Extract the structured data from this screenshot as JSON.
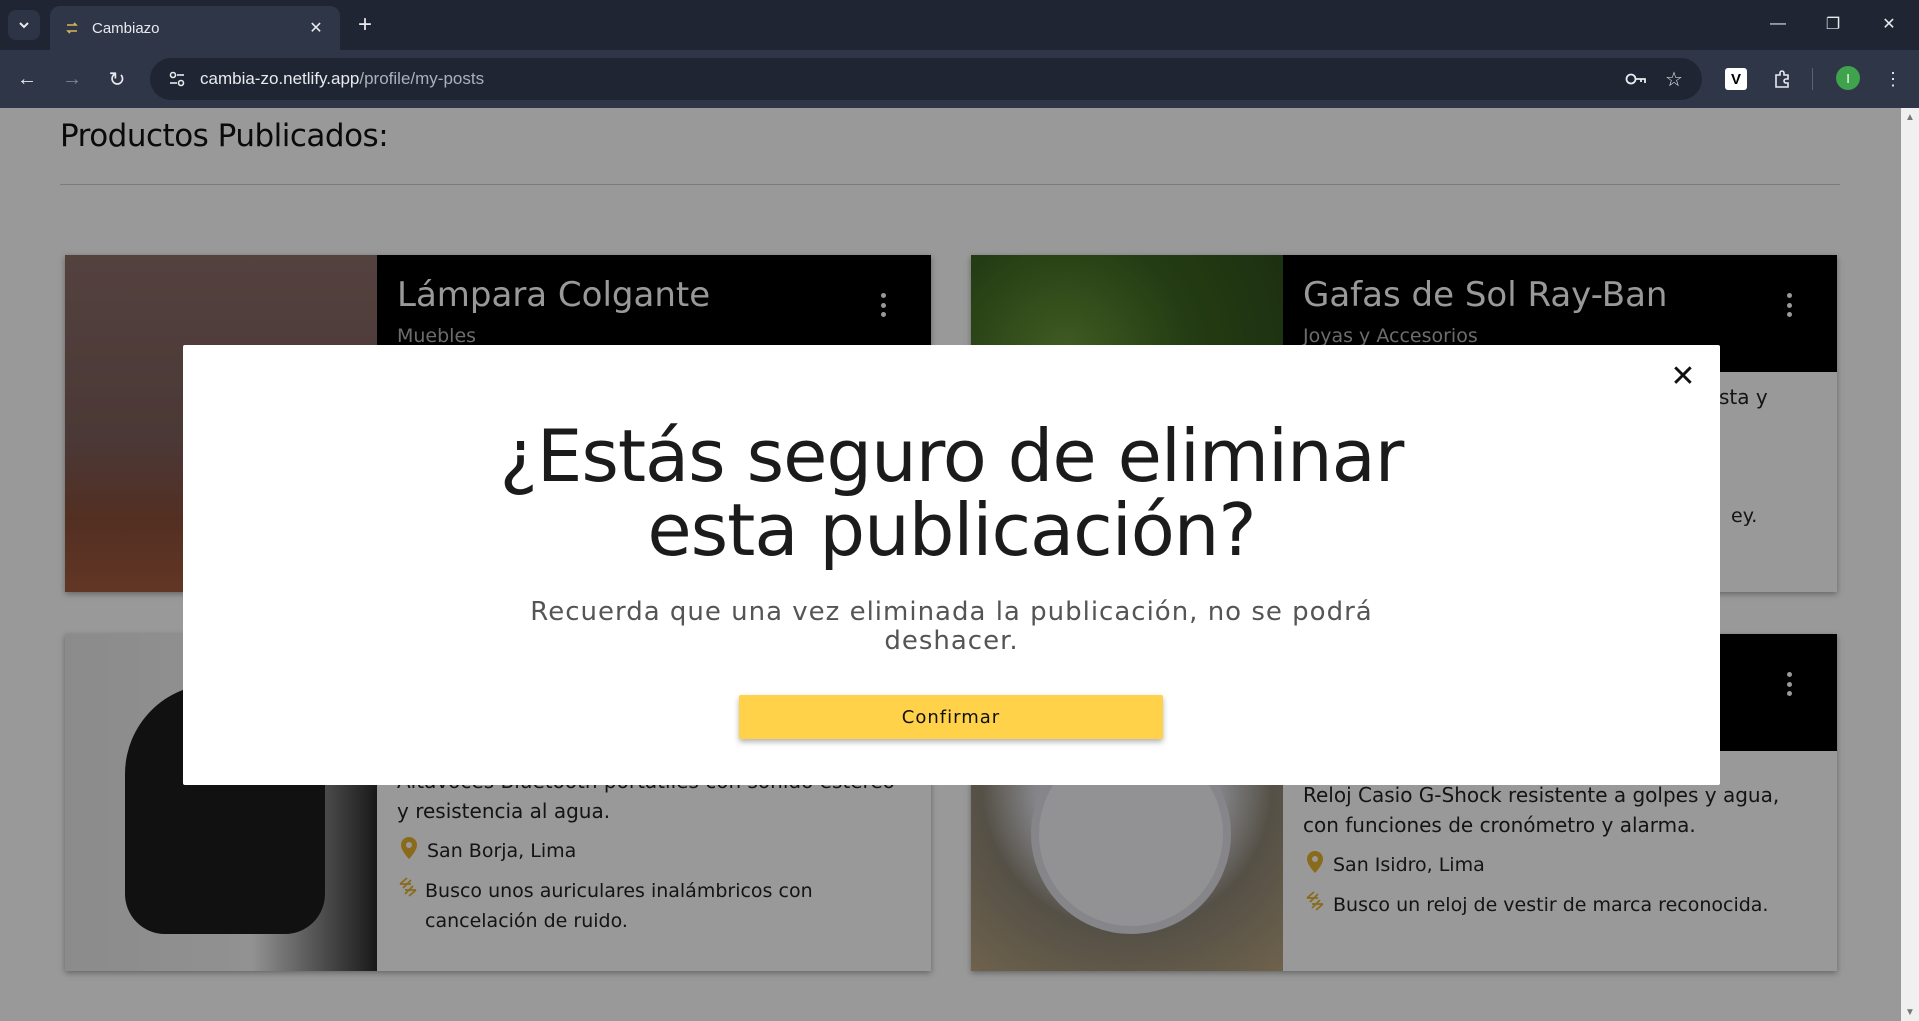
{
  "browser": {
    "tab_title": "Cambiazo",
    "url_host": "cambia-zo.netlify.app",
    "url_path": "/profile/my-posts",
    "profile_initial": "I"
  },
  "page": {
    "heading": "Productos Publicados:"
  },
  "cards": [
    {
      "title": "Lámpara Colgante",
      "category": "Muebles",
      "description": "",
      "location": "",
      "wants": ""
    },
    {
      "title": "Gafas de Sol Ray-Ban",
      "category": "Joyas y Accesorios",
      "desc_fragment": "sta y",
      "wants_fragment": "ey."
    },
    {
      "title": "",
      "category": "",
      "description": "Altavoces Bluetooth portátiles con sonido estéreo y resistencia al agua.",
      "location": "San Borja, Lima",
      "wants": "Busco unos auriculares inalámbricos con cancelación de ruido."
    },
    {
      "title": "",
      "category": "",
      "description": "Reloj Casio G-Shock resistente a golpes y agua, con funciones de cronómetro y alarma.",
      "location": "San Isidro, Lima",
      "wants": "Busco un reloj de vestir de marca reconocida."
    }
  ],
  "modal": {
    "title_line1": "¿Estás seguro de eliminar",
    "title_line2": "esta publicación?",
    "message": "Recuerda que una vez eliminada la publicación, no se podrá deshacer.",
    "confirm_label": "Confirmar"
  },
  "colors": {
    "accent": "#ffd24a",
    "card_header": "#000000",
    "icon": "#e6b32e"
  },
  "icons": {
    "close": "close-icon",
    "location": "location-pin-icon",
    "exchange": "exchange-icon",
    "menu": "kebab-menu-icon"
  }
}
